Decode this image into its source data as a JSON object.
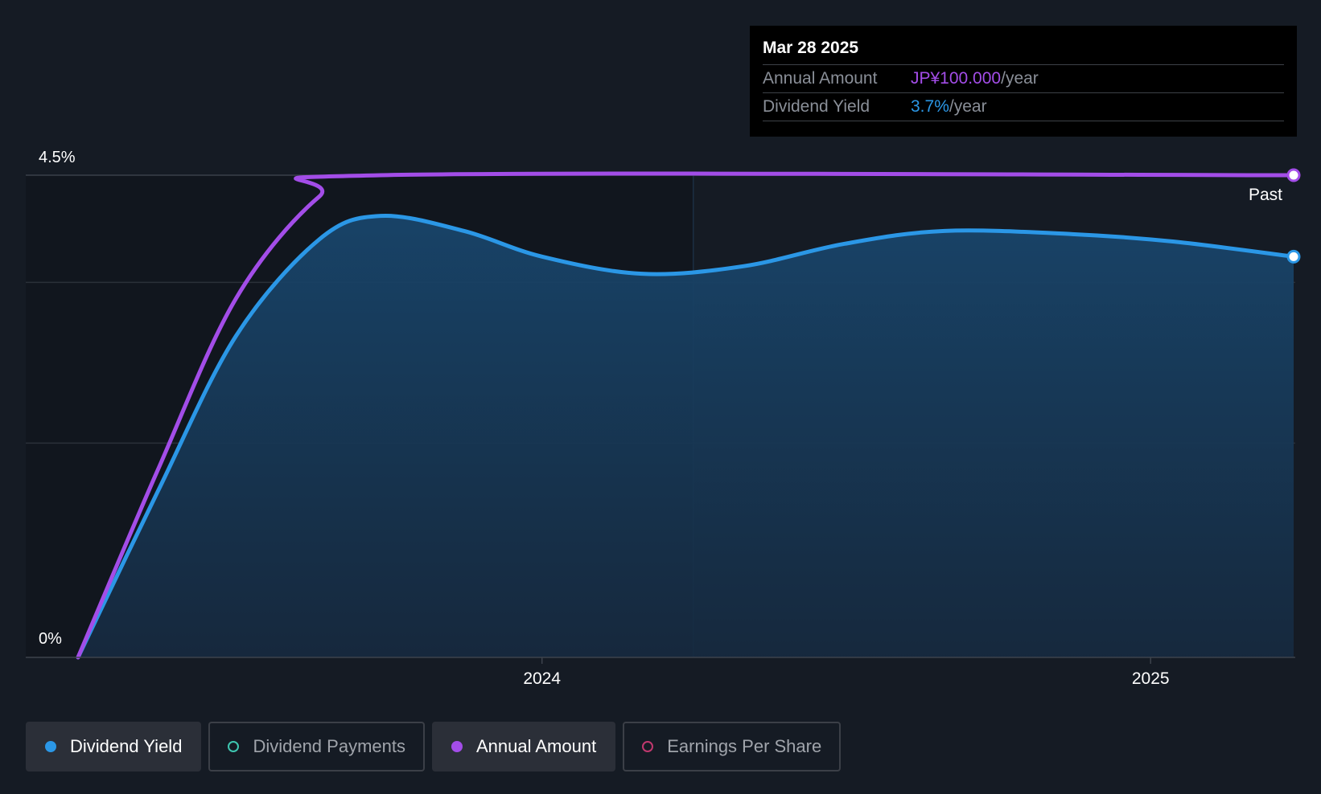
{
  "chart_data": {
    "type": "area",
    "x_start": "2023-03-28",
    "x_end": "2025-03-28",
    "xticks": [
      {
        "label": "2024",
        "date": "2024-01-01"
      },
      {
        "label": "2025",
        "date": "2025-01-01"
      }
    ],
    "y_labels": {
      "top": "4.5%",
      "bottom": "0%"
    },
    "ylim": [
      0,
      4.5
    ],
    "series": [
      {
        "name": "Dividend Yield",
        "color": "#2b97e6",
        "unit": "%",
        "points": [
          {
            "date": "2023-03-28",
            "value": 0.0
          },
          {
            "date": "2023-05-15",
            "value": 1.55
          },
          {
            "date": "2023-07-01",
            "value": 3.0
          },
          {
            "date": "2023-08-20",
            "value": 3.9
          },
          {
            "date": "2023-09-26",
            "value": 4.12
          },
          {
            "date": "2023-11-15",
            "value": 3.98
          },
          {
            "date": "2024-01-01",
            "value": 3.74
          },
          {
            "date": "2024-03-01",
            "value": 3.58
          },
          {
            "date": "2024-05-01",
            "value": 3.65
          },
          {
            "date": "2024-07-01",
            "value": 3.86
          },
          {
            "date": "2024-08-30",
            "value": 3.98
          },
          {
            "date": "2024-11-15",
            "value": 3.95
          },
          {
            "date": "2025-01-15",
            "value": 3.88
          },
          {
            "date": "2025-03-28",
            "value": 3.74
          }
        ]
      },
      {
        "name": "Annual Amount",
        "color": "#a34de8",
        "unit": "JP¥",
        "points": [
          {
            "date": "2023-03-28",
            "value": 0.0
          },
          {
            "date": "2023-05-15",
            "value": 1.75
          },
          {
            "date": "2023-07-01",
            "value": 3.35
          },
          {
            "date": "2023-08-20",
            "value": 4.3
          },
          {
            "date": "2023-09-26",
            "value": 4.5
          },
          {
            "date": "2025-03-28",
            "value": 4.5
          }
        ]
      }
    ],
    "highlight_start": "2024-04-01",
    "past_label": "Past",
    "grid": true
  },
  "tooltip": {
    "date": "Mar 28 2025",
    "rows": [
      {
        "label": "Annual Amount",
        "value": "JP¥100.000",
        "unit": "/year",
        "color": "#a34de8"
      },
      {
        "label": "Dividend Yield",
        "value": "3.7%",
        "unit": "/year",
        "color": "#2b97e6"
      }
    ]
  },
  "legend": [
    {
      "label": "Dividend Yield",
      "color": "#2b97e6",
      "active": true,
      "filled": true
    },
    {
      "label": "Dividend Payments",
      "color": "#3ec6b0",
      "active": false,
      "filled": false
    },
    {
      "label": "Annual Amount",
      "color": "#a34de8",
      "active": true,
      "filled": true
    },
    {
      "label": "Earnings Per Share",
      "color": "#c0386e",
      "active": false,
      "filled": false
    }
  ],
  "colors": {
    "background": "#151b24",
    "grid": "#2c323b",
    "axis": "#3d434c",
    "area_top": "#173d5f",
    "text": "#ffffff"
  }
}
